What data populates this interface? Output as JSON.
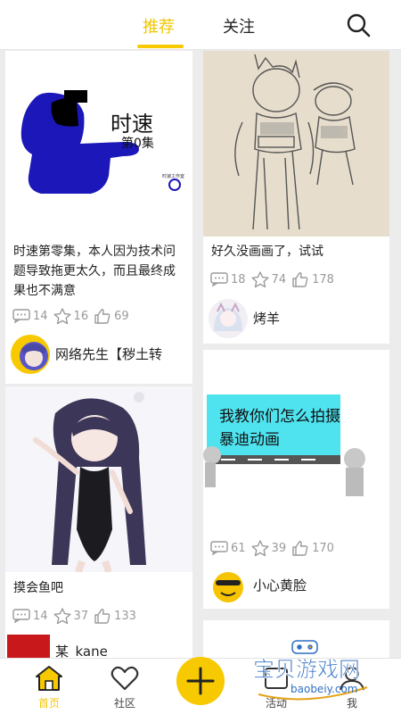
{
  "header": {
    "tabs": [
      {
        "label": "推荐",
        "active": true
      },
      {
        "label": "关注",
        "active": false
      }
    ],
    "accent_color": "#f7c900",
    "search_icon": "search-icon"
  },
  "feed": {
    "posts": [
      {
        "image_text": {
          "title": "时速",
          "episode": "第0集",
          "mark": "时速工作室"
        },
        "title": "时速第零集，本人因为技术问题导致拖更太久，而且最终成果也不满意",
        "comments": "14",
        "likes": "16",
        "thumbs": "69",
        "author": "网络先生【秽土转"
      },
      {
        "title": "好久没画画了，试试",
        "comments": "18",
        "likes": "74",
        "thumbs": "178",
        "author": "烤羊"
      },
      {
        "title": "摸会鱼吧",
        "comments": "14",
        "likes": "37",
        "thumbs": "133",
        "author": "某_kane"
      },
      {
        "image_text": {
          "line1": "我教你们怎么拍摄",
          "line2": "暴迪动画"
        },
        "comments": "61",
        "likes": "39",
        "thumbs": "170",
        "author": "小心黄脸"
      }
    ]
  },
  "bottom_nav": {
    "items": [
      {
        "label": "首页",
        "icon": "home-icon",
        "active": true
      },
      {
        "label": "社区",
        "icon": "heart-icon",
        "active": false
      },
      {
        "label": "",
        "icon": "plus-icon"
      },
      {
        "label": "活动",
        "icon": "activity-icon",
        "active": false
      },
      {
        "label": "我",
        "icon": "user-icon",
        "active": false
      }
    ],
    "active_color": "#f3c600"
  },
  "watermark": {
    "text": "宝贝游戏网",
    "url": "baobeiy.com"
  }
}
